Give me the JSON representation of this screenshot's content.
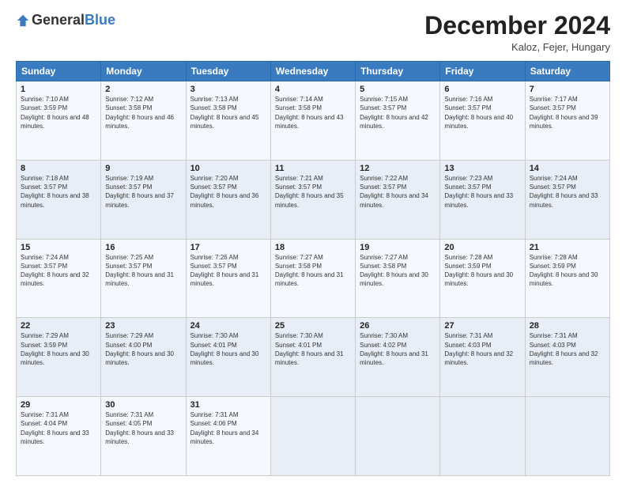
{
  "logo": {
    "general": "General",
    "blue": "Blue"
  },
  "header": {
    "month": "December 2024",
    "location": "Kaloz, Fejer, Hungary"
  },
  "weekdays": [
    "Sunday",
    "Monday",
    "Tuesday",
    "Wednesday",
    "Thursday",
    "Friday",
    "Saturday"
  ],
  "weeks": [
    [
      {
        "day": "1",
        "sunrise": "Sunrise: 7:10 AM",
        "sunset": "Sunset: 3:59 PM",
        "daylight": "Daylight: 8 hours and 48 minutes."
      },
      {
        "day": "2",
        "sunrise": "Sunrise: 7:12 AM",
        "sunset": "Sunset: 3:58 PM",
        "daylight": "Daylight: 8 hours and 46 minutes."
      },
      {
        "day": "3",
        "sunrise": "Sunrise: 7:13 AM",
        "sunset": "Sunset: 3:58 PM",
        "daylight": "Daylight: 8 hours and 45 minutes."
      },
      {
        "day": "4",
        "sunrise": "Sunrise: 7:14 AM",
        "sunset": "Sunset: 3:58 PM",
        "daylight": "Daylight: 8 hours and 43 minutes."
      },
      {
        "day": "5",
        "sunrise": "Sunrise: 7:15 AM",
        "sunset": "Sunset: 3:57 PM",
        "daylight": "Daylight: 8 hours and 42 minutes."
      },
      {
        "day": "6",
        "sunrise": "Sunrise: 7:16 AM",
        "sunset": "Sunset: 3:57 PM",
        "daylight": "Daylight: 8 hours and 40 minutes."
      },
      {
        "day": "7",
        "sunrise": "Sunrise: 7:17 AM",
        "sunset": "Sunset: 3:57 PM",
        "daylight": "Daylight: 8 hours and 39 minutes."
      }
    ],
    [
      {
        "day": "8",
        "sunrise": "Sunrise: 7:18 AM",
        "sunset": "Sunset: 3:57 PM",
        "daylight": "Daylight: 8 hours and 38 minutes."
      },
      {
        "day": "9",
        "sunrise": "Sunrise: 7:19 AM",
        "sunset": "Sunset: 3:57 PM",
        "daylight": "Daylight: 8 hours and 37 minutes."
      },
      {
        "day": "10",
        "sunrise": "Sunrise: 7:20 AM",
        "sunset": "Sunset: 3:57 PM",
        "daylight": "Daylight: 8 hours and 36 minutes."
      },
      {
        "day": "11",
        "sunrise": "Sunrise: 7:21 AM",
        "sunset": "Sunset: 3:57 PM",
        "daylight": "Daylight: 8 hours and 35 minutes."
      },
      {
        "day": "12",
        "sunrise": "Sunrise: 7:22 AM",
        "sunset": "Sunset: 3:57 PM",
        "daylight": "Daylight: 8 hours and 34 minutes."
      },
      {
        "day": "13",
        "sunrise": "Sunrise: 7:23 AM",
        "sunset": "Sunset: 3:57 PM",
        "daylight": "Daylight: 8 hours and 33 minutes."
      },
      {
        "day": "14",
        "sunrise": "Sunrise: 7:24 AM",
        "sunset": "Sunset: 3:57 PM",
        "daylight": "Daylight: 8 hours and 33 minutes."
      }
    ],
    [
      {
        "day": "15",
        "sunrise": "Sunrise: 7:24 AM",
        "sunset": "Sunset: 3:57 PM",
        "daylight": "Daylight: 8 hours and 32 minutes."
      },
      {
        "day": "16",
        "sunrise": "Sunrise: 7:25 AM",
        "sunset": "Sunset: 3:57 PM",
        "daylight": "Daylight: 8 hours and 31 minutes."
      },
      {
        "day": "17",
        "sunrise": "Sunrise: 7:26 AM",
        "sunset": "Sunset: 3:57 PM",
        "daylight": "Daylight: 8 hours and 31 minutes."
      },
      {
        "day": "18",
        "sunrise": "Sunrise: 7:27 AM",
        "sunset": "Sunset: 3:58 PM",
        "daylight": "Daylight: 8 hours and 31 minutes."
      },
      {
        "day": "19",
        "sunrise": "Sunrise: 7:27 AM",
        "sunset": "Sunset: 3:58 PM",
        "daylight": "Daylight: 8 hours and 30 minutes."
      },
      {
        "day": "20",
        "sunrise": "Sunrise: 7:28 AM",
        "sunset": "Sunset: 3:59 PM",
        "daylight": "Daylight: 8 hours and 30 minutes."
      },
      {
        "day": "21",
        "sunrise": "Sunrise: 7:28 AM",
        "sunset": "Sunset: 3:59 PM",
        "daylight": "Daylight: 8 hours and 30 minutes."
      }
    ],
    [
      {
        "day": "22",
        "sunrise": "Sunrise: 7:29 AM",
        "sunset": "Sunset: 3:59 PM",
        "daylight": "Daylight: 8 hours and 30 minutes."
      },
      {
        "day": "23",
        "sunrise": "Sunrise: 7:29 AM",
        "sunset": "Sunset: 4:00 PM",
        "daylight": "Daylight: 8 hours and 30 minutes."
      },
      {
        "day": "24",
        "sunrise": "Sunrise: 7:30 AM",
        "sunset": "Sunset: 4:01 PM",
        "daylight": "Daylight: 8 hours and 30 minutes."
      },
      {
        "day": "25",
        "sunrise": "Sunrise: 7:30 AM",
        "sunset": "Sunset: 4:01 PM",
        "daylight": "Daylight: 8 hours and 31 minutes."
      },
      {
        "day": "26",
        "sunrise": "Sunrise: 7:30 AM",
        "sunset": "Sunset: 4:02 PM",
        "daylight": "Daylight: 8 hours and 31 minutes."
      },
      {
        "day": "27",
        "sunrise": "Sunrise: 7:31 AM",
        "sunset": "Sunset: 4:03 PM",
        "daylight": "Daylight: 8 hours and 32 minutes."
      },
      {
        "day": "28",
        "sunrise": "Sunrise: 7:31 AM",
        "sunset": "Sunset: 4:03 PM",
        "daylight": "Daylight: 8 hours and 32 minutes."
      }
    ],
    [
      {
        "day": "29",
        "sunrise": "Sunrise: 7:31 AM",
        "sunset": "Sunset: 4:04 PM",
        "daylight": "Daylight: 8 hours and 33 minutes."
      },
      {
        "day": "30",
        "sunrise": "Sunrise: 7:31 AM",
        "sunset": "Sunset: 4:05 PM",
        "daylight": "Daylight: 8 hours and 33 minutes."
      },
      {
        "day": "31",
        "sunrise": "Sunrise: 7:31 AM",
        "sunset": "Sunset: 4:06 PM",
        "daylight": "Daylight: 8 hours and 34 minutes."
      },
      null,
      null,
      null,
      null
    ]
  ]
}
